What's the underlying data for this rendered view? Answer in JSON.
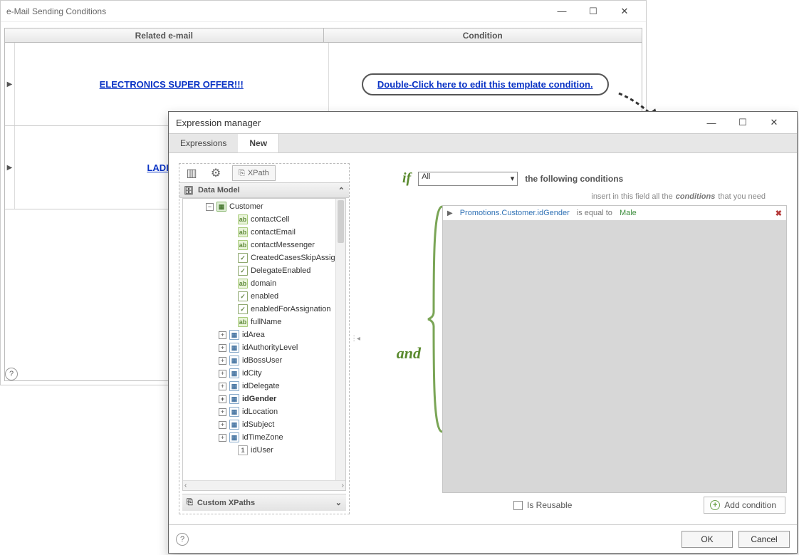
{
  "outer": {
    "title": "e-Mail Sending Conditions",
    "col1": "Related e-mail",
    "col2": "Condition",
    "row1": {
      "email": "ELECTRONICS SUPER OFFER!!!",
      "condition": "Double-Click here to edit this template condition."
    },
    "row2": {
      "email": "LADIES ES"
    }
  },
  "expr": {
    "title": "Expression manager",
    "tabs": {
      "expressions": "Expressions",
      "new": "New"
    },
    "toolbar": {
      "xpath": "XPath"
    },
    "data_model_header": "Data Model",
    "custom_xpaths": "Custom XPaths",
    "tree_root": "Customer",
    "tree": [
      {
        "label": "contactCell",
        "icon": "text",
        "indent": 62
      },
      {
        "label": "contactEmail",
        "icon": "text",
        "indent": 62
      },
      {
        "label": "contactMessenger",
        "icon": "text",
        "indent": 62
      },
      {
        "label": "CreatedCasesSkipAssigR",
        "icon": "bool",
        "indent": 62
      },
      {
        "label": "DelegateEnabled",
        "icon": "bool",
        "indent": 62
      },
      {
        "label": "domain",
        "icon": "text",
        "indent": 62
      },
      {
        "label": "enabled",
        "icon": "bool",
        "indent": 62
      },
      {
        "label": "enabledForAssignation",
        "icon": "bool",
        "indent": 62
      },
      {
        "label": "fullName",
        "icon": "text",
        "indent": 62
      },
      {
        "label": "idArea",
        "icon": "ref",
        "indent": 50,
        "expand": true
      },
      {
        "label": "idAuthorityLevel",
        "icon": "ref",
        "indent": 50,
        "expand": true
      },
      {
        "label": "idBossUser",
        "icon": "ref",
        "indent": 50,
        "expand": true
      },
      {
        "label": "idCity",
        "icon": "ref",
        "indent": 50,
        "expand": true
      },
      {
        "label": "idDelegate",
        "icon": "ref",
        "indent": 50,
        "expand": true
      },
      {
        "label": "idGender",
        "icon": "ref",
        "indent": 50,
        "expand": true,
        "bold": true
      },
      {
        "label": "idLocation",
        "icon": "ref",
        "indent": 50,
        "expand": true
      },
      {
        "label": "idSubject",
        "icon": "ref",
        "indent": 50,
        "expand": true
      },
      {
        "label": "idTimeZone",
        "icon": "ref",
        "indent": 50,
        "expand": true
      },
      {
        "label": "idUser",
        "icon": "num",
        "indent": 62
      }
    ],
    "if_label": "if",
    "if_select": "All",
    "if_following": "the following conditions",
    "hint_pre": "insert in this field all the",
    "hint_em": "conditions",
    "hint_post": "that you need",
    "and_label": "and",
    "condition": {
      "path": "Promotions.Customer.idGender",
      "op": "is equal to",
      "val": "Male"
    },
    "reusable": "Is Reusable",
    "add_condition": "Add condition",
    "ok": "OK",
    "cancel": "Cancel"
  }
}
